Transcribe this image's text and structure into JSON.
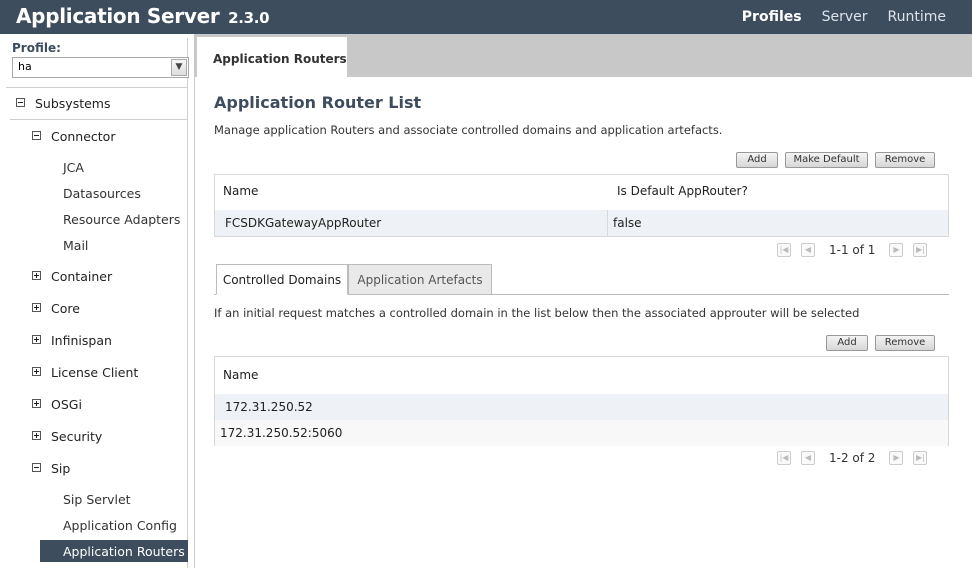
{
  "header": {
    "title": "Application Server",
    "version": "2.3.0",
    "nav": [
      "Profiles",
      "Server",
      "Runtime"
    ]
  },
  "sidebar": {
    "profile_label": "Profile:",
    "profile_value": "ha",
    "root": "Subsystems",
    "connector": "Connector",
    "connector_items": [
      "JCA",
      "Datasources",
      "Resource Adapters",
      "Mail"
    ],
    "collapsed": [
      "Container",
      "Core",
      "Infinispan",
      "License Client",
      "OSGi",
      "Security"
    ],
    "sip": "Sip",
    "sip_items": [
      "Sip Servlet",
      "Application Config",
      "Application Routers"
    ]
  },
  "main": {
    "tab": "Application Routers",
    "title": "Application Router List",
    "description": "Manage application Routers and associate controlled domains and application artefacts.",
    "buttons": {
      "add": "Add",
      "make_default": "Make Default",
      "remove": "Remove"
    },
    "routers": {
      "columns": [
        "Name",
        "Is Default AppRouter?"
      ],
      "rows": [
        {
          "name": "FCSDKGatewayAppRouter",
          "is_default": "false"
        }
      ],
      "pager": "1-1 of 1"
    },
    "subtabs": [
      "Controlled Domains",
      "Application Artefacts"
    ],
    "domains_note": "If an initial request matches a controlled domain in the list below then the associated approuter will be selected",
    "domain_buttons": {
      "add": "Add",
      "remove": "Remove"
    },
    "domains": {
      "column": "Name",
      "rows": [
        "172.31.250.52",
        "172.31.250.52:5060"
      ],
      "pager": "1-2 of 2"
    }
  }
}
